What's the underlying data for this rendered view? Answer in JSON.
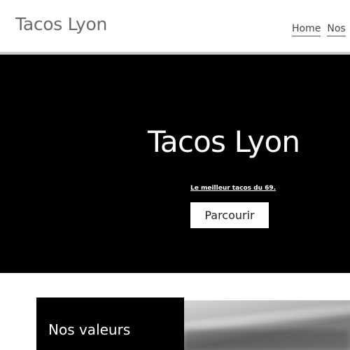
{
  "header": {
    "site_title": "Tacos Lyon",
    "nav": [
      {
        "label": "Home"
      },
      {
        "label": "Nos"
      }
    ]
  },
  "hero": {
    "title": "Tacos Lyon",
    "tagline": "Le meilleur tacos du 69.",
    "button_label": "Parcourir"
  },
  "values_section": {
    "title": "Nos valeurs"
  },
  "colors": {
    "hero_background": "#000000",
    "header_background": "#ffffff",
    "title_text": "#6b6b6b",
    "header_rule": "#cccccc"
  }
}
